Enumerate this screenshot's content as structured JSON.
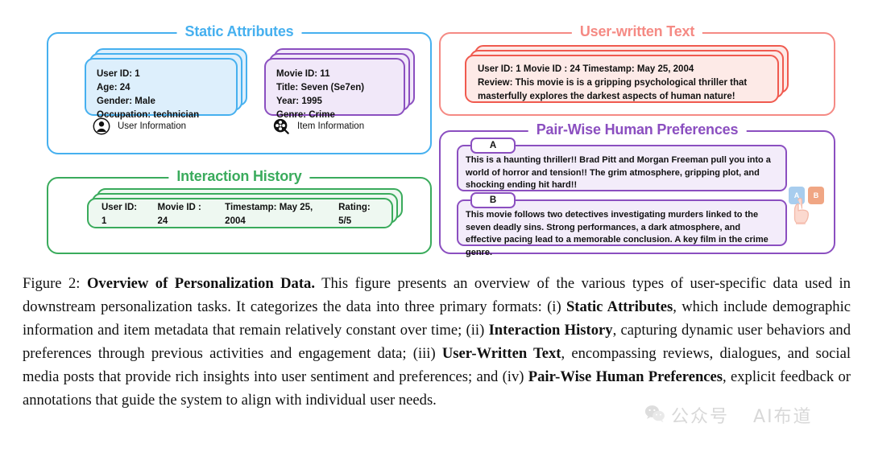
{
  "panels": {
    "static_attributes": {
      "title": "Static Attributes",
      "color": "#46b0ef",
      "user_card": {
        "line1": "User ID: 1",
        "line2": "Age: 24",
        "line3": "Gender: Male",
        "line4": "Occupation: technician"
      },
      "item_card": {
        "line1": "Movie ID: 11",
        "line2": "Title: Seven (Se7en)",
        "line3": "Year: 1995",
        "line4": "Genre: Crime"
      },
      "legend_user": "User Information",
      "legend_item": "Item Information"
    },
    "interaction_history": {
      "title": "Interaction History",
      "color": "#3aab5c",
      "record": {
        "user_id": "User ID: 1",
        "movie_id": "Movie ID : 24",
        "timestamp": "Timestamp: May 25, 2004",
        "rating": "Rating: 5/5"
      }
    },
    "user_written_text": {
      "title": "User-written Text",
      "color": "#f58a84",
      "record": {
        "meta": "User ID: 1     Movie ID : 24    Timestamp: May 25, 2004",
        "review": "Review: This movie is is a gripping psychological thriller that masterfully explores the darkest aspects of human nature!"
      }
    },
    "pairwise_preferences": {
      "title": "Pair-Wise Human Preferences",
      "color": "#8b4fc0",
      "option_a": {
        "tag": "A",
        "text": "This is a haunting thriller!! Brad Pitt and Morgan Freeman pull you into a world of horror and tension!! The grim atmosphere, gripping plot, and shocking ending hit hard!!"
      },
      "option_b": {
        "tag": "B",
        "text": "This movie follows two detectives investigating murders linked to the seven deadly sins. Strong performances, a dark atmosphere, and effective pacing lead to a memorable conclusion. A key film in the crime genre."
      },
      "chooser": {
        "a_label": "A",
        "b_label": "B",
        "a_color": "#a8cdee",
        "b_color": "#f0a684"
      }
    }
  },
  "caption": {
    "figure_label": "Figure 2:",
    "bold_title": "Overview of Personalization Data.",
    "seg1": " This figure presents an overview of the various types of user-specific data used in downstream personalization tasks. It categorizes the data into three primary formats: (i) ",
    "b1": "Static Attributes",
    "seg2": ", which include demographic information and item metadata that remain relatively constant over time; (ii) ",
    "b2": "Interaction History",
    "seg3": ", capturing dynamic user behaviors and preferences through previous activities and engagement data; (iii) ",
    "b3": "User-Written Text",
    "seg4": ", encompassing reviews, dialogues, and social media posts that provide rich insights into user sentiment and preferences; and (iv) ",
    "b4": "Pair-Wise Human Preferences",
    "seg5": ", explicit feedback or annotations that guide the system to align with individual user needs."
  },
  "watermark": {
    "text_left": "公众号",
    "text_right": "AI布道"
  }
}
